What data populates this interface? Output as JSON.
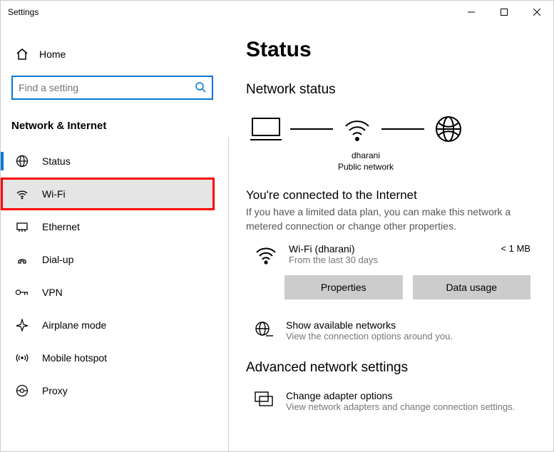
{
  "window": {
    "title": "Settings"
  },
  "sidebar": {
    "home": "Home",
    "search_placeholder": "Find a setting",
    "category": "Network & Internet",
    "items": [
      {
        "label": "Status"
      },
      {
        "label": "Wi-Fi"
      },
      {
        "label": "Ethernet"
      },
      {
        "label": "Dial-up"
      },
      {
        "label": "VPN"
      },
      {
        "label": "Airplane mode"
      },
      {
        "label": "Mobile hotspot"
      },
      {
        "label": "Proxy"
      }
    ]
  },
  "main": {
    "title": "Status",
    "network_status_heading": "Network status",
    "diagram": {
      "router_label": "dharani",
      "network_type": "Public network"
    },
    "connected_heading": "You're connected to the Internet",
    "connected_desc": "If you have a limited data plan, you can make this network a metered connection or change other properties.",
    "wifi": {
      "name": "Wi-Fi (dharani)",
      "meta": "From the last 30 days",
      "usage": "< 1 MB"
    },
    "buttons": {
      "properties": "Properties",
      "data_usage": "Data usage"
    },
    "available": {
      "title": "Show available networks",
      "desc": "View the connection options around you."
    },
    "advanced_heading": "Advanced network settings",
    "adapter": {
      "title": "Change adapter options",
      "desc": "View network adapters and change connection settings."
    }
  }
}
